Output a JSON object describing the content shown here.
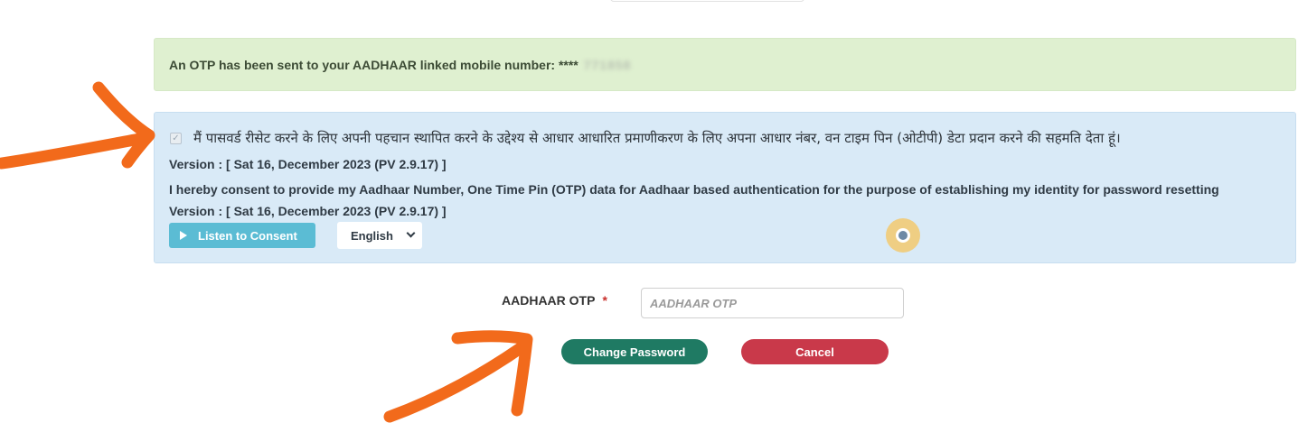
{
  "otp_alert": {
    "message": "An OTP has been sent to your AADHAAR linked mobile number: ****",
    "masked_digits": "771858"
  },
  "consent": {
    "checked": true,
    "checkbox_glyph": "✓",
    "hindi_text": "मैं पासवर्ड रीसेट करने के लिए अपनी पहचान स्थापित करने के उद्देश्य से आधार आधारित प्रमाणीकरण के लिए अपना आधार नंबर, वन टाइम पिन (ओटीपी) डेटा प्रदान करने की सहमति देता हूं।",
    "version_text": "Version : [ Sat 16, December 2023 (PV 2.9.17) ]",
    "english_text": "I hereby consent to provide my Aadhaar Number, One Time Pin (OTP) data for Aadhaar based authentication for the purpose of establishing my identity for password resetting Version : [ Sat 16, December 2023 (PV 2.9.17) ]",
    "listen_label": "Listen to Consent",
    "language_selected": "English"
  },
  "otp_field": {
    "label": "AADHAAR OTP",
    "required_mark": "*",
    "placeholder": "AADHAAR OTP",
    "value": ""
  },
  "actions": {
    "change_password_label": "Change Password",
    "cancel_label": "Cancel"
  },
  "colors": {
    "alert_bg": "#dff0d0",
    "consent_bg": "#d9eaf7",
    "listen_button": "#5bbcd4",
    "change_password": "#1f7a63",
    "cancel": "#c9394a",
    "annotation_arrow": "#f26a1b"
  },
  "icons": {
    "listen": "play-icon",
    "language_dropdown": "chevron-down-icon"
  }
}
